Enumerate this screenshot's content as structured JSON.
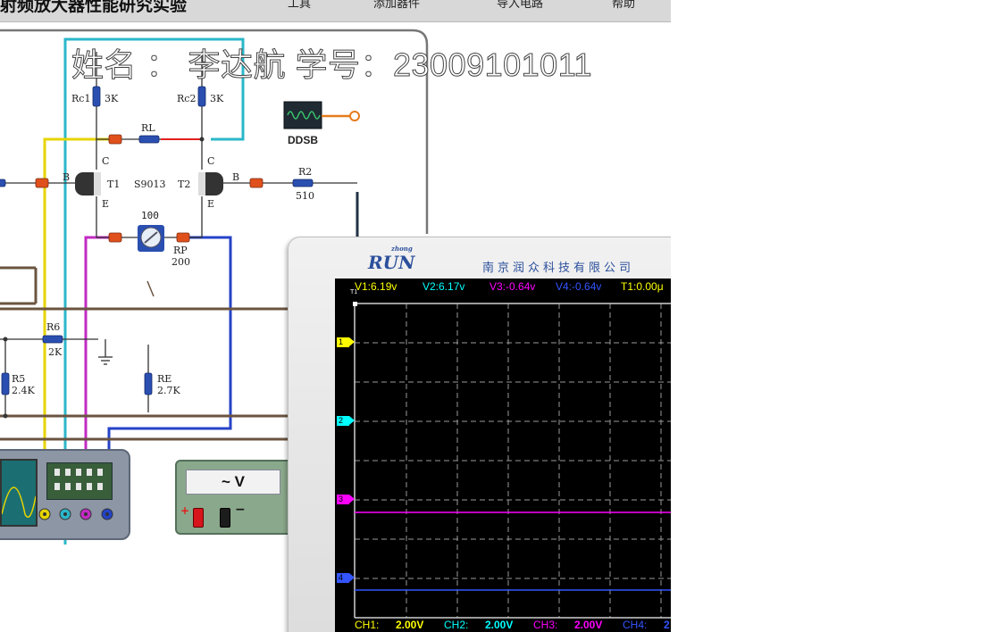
{
  "app": {
    "title": "射频放大器性能研究实验",
    "menu": [
      "工具",
      "添加器件",
      "导入电路",
      "帮助"
    ]
  },
  "student": {
    "text": "姓名 ： 李达航  学号：23009101011"
  },
  "circuit": {
    "labels": {
      "rc1": "Rc1",
      "rc1_val": "3K",
      "rc2": "Rc2",
      "rc2_val": "3K",
      "rl": "RL",
      "t1": "T1",
      "t2": "T2",
      "transistor": "S9013",
      "c1": "C",
      "c2": "C",
      "b1": "B",
      "b2": "B",
      "e1": "E",
      "e2": "E",
      "r2": "R2",
      "r2_val": "510",
      "rp": "RP",
      "rp_val": "200",
      "pot_dial": "100",
      "r6": "R6",
      "r6_val": "2K",
      "r5": "R5",
      "r5_val": "2.4K",
      "re": "RE",
      "re_val": "2.7K",
      "ddsb": "DDSB"
    }
  },
  "meter": {
    "display": "~ V",
    "plus": "+",
    "minus": "−"
  },
  "oscilloscope": {
    "brand": "RUN",
    "brand_small": "zhong",
    "company": "南京润众科技有限公司",
    "readouts": {
      "v1": "V1:6.19v",
      "v2": "V2:6.17v",
      "v3": "V3:-0.64v",
      "v4": "V4:-0.64v",
      "t1": "T1:0.00μ"
    },
    "channels": [
      {
        "name": "CH1:",
        "scale": "2.00V",
        "color": "#ffff00",
        "marker": "1"
      },
      {
        "name": "CH2:",
        "scale": "2.00V",
        "color": "#00ffff",
        "marker": "2"
      },
      {
        "name": "CH3:",
        "scale": "2.00V",
        "color": "#ff00ff",
        "marker": "3"
      },
      {
        "name": "CH4:",
        "scale": "2",
        "color": "#3355ff",
        "marker": "4"
      }
    ],
    "trigger_marker": "T1"
  },
  "colors": {
    "ch1": "#ffff00",
    "ch2": "#00ffff",
    "ch3": "#ff00ff",
    "ch4": "#3355ff",
    "wire_yellow": "#e6d400",
    "wire_cyan": "#2ab7c9",
    "wire_magenta": "#c22ac2",
    "wire_blue": "#2442c7",
    "wire_red": "#e0201c",
    "wire_brown": "#6b5440"
  }
}
